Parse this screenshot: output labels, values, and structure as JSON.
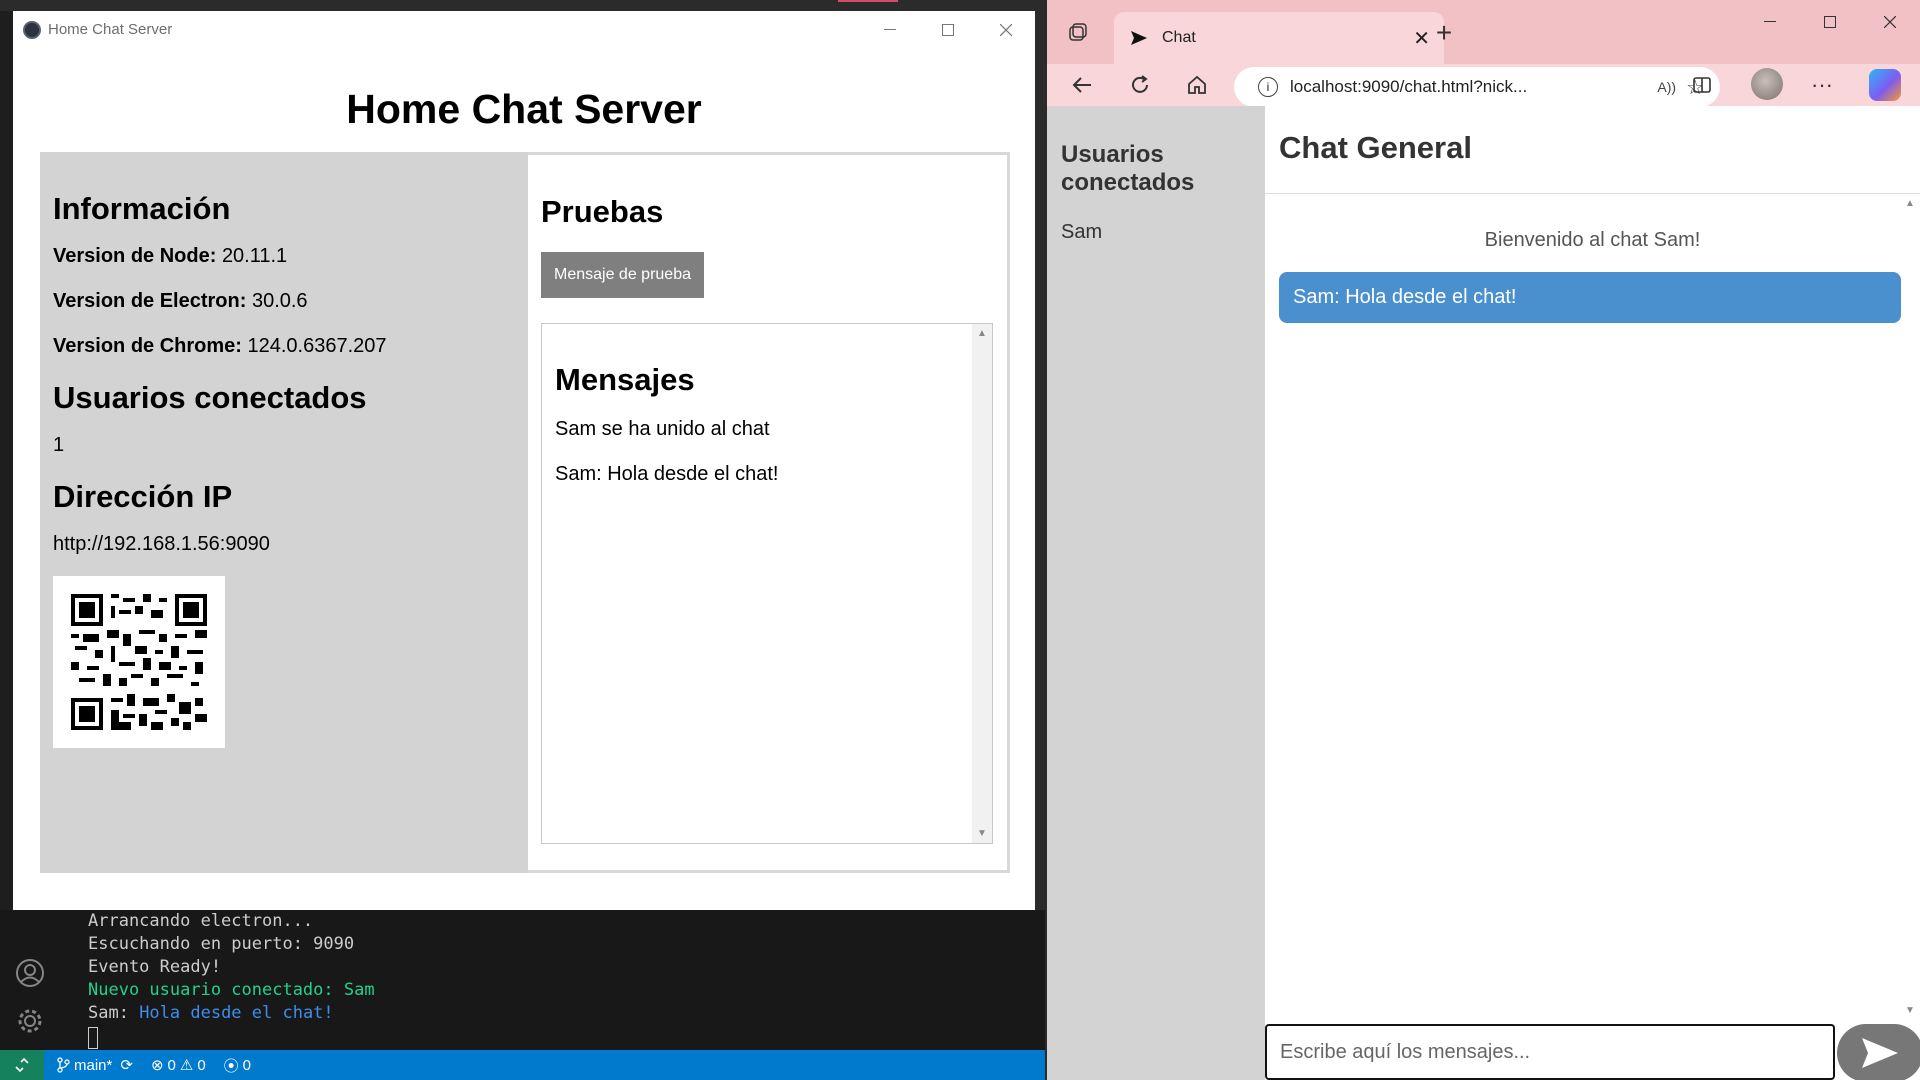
{
  "electron": {
    "window_title": "Home Chat Server",
    "heading": "Home Chat Server",
    "info": {
      "title": "Información",
      "node_label": "Version de Node:",
      "node_value": "20.11.1",
      "electron_label": "Version de Electron:",
      "electron_value": "30.0.6",
      "chrome_label": "Version de Chrome:",
      "chrome_value": "124.0.6367.207",
      "users_title": "Usuarios conectados",
      "users_count": "1",
      "ip_title": "Dirección IP",
      "ip_value": "http://192.168.1.56:9090"
    },
    "tests": {
      "title": "Pruebas",
      "button_label": "Mensaje de prueba",
      "messages_title": "Mensajes",
      "messages": [
        "Sam se ha unido al chat",
        "Sam: Hola desde el chat!"
      ]
    }
  },
  "terminal": {
    "lines": [
      "Arrancando electron...",
      "Escuchando en puerto: 9090",
      "Evento Ready!"
    ],
    "new_user_line": "Nuevo usuario conectado: Sam",
    "msg_prefix": "Sam: ",
    "msg_text": "Hola desde el chat!"
  },
  "status_bar": {
    "branch": "main*",
    "errors": "0",
    "warnings": "0",
    "ports": "0"
  },
  "browser": {
    "tab_title": "Chat",
    "url": "localhost:9090/chat.html?nick..."
  },
  "chat": {
    "sidebar_title": "Usuarios conectados",
    "users": [
      "Sam"
    ],
    "header": "Chat General",
    "welcome": "Bienvenido al chat Sam!",
    "message": "Sam: Hola desde el chat!",
    "input_placeholder": "Escribe aquí los mensajes..."
  },
  "colors": {
    "edge_tabbar": "#f2c1c6",
    "chat_bubble": "#4a8fce",
    "vscode_status": "#007acc",
    "terminal_green": "#23d18b",
    "terminal_blue": "#3b8eea"
  }
}
